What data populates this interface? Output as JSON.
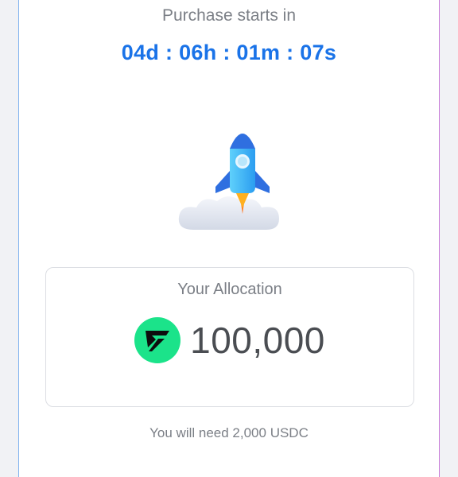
{
  "purchase": {
    "title": "Purchase starts in",
    "countdown": "04d : 06h : 01m : 07s"
  },
  "allocation": {
    "title": "Your Allocation",
    "token_icon": "token-logo-icon",
    "amount": "100,000"
  },
  "requirement": "You will need 2,000 USDC",
  "colors": {
    "countdown": "#1a73e8",
    "token_bg": "#1be38a",
    "border_left": "#7fb2ee",
    "border_right": "#c77ad8"
  }
}
